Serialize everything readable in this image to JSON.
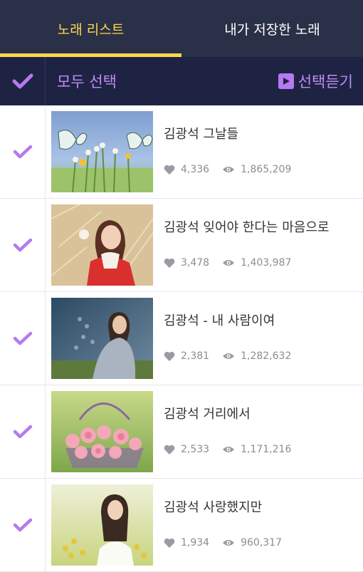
{
  "tabs": [
    {
      "label": "노래 리스트",
      "active": true
    },
    {
      "label": "내가 저장한 노래",
      "active": false
    }
  ],
  "select_bar": {
    "select_all_label": "모두 선택",
    "listen_label": "선택듣기"
  },
  "colors": {
    "accent_purple": "#b57af0",
    "tab_underline": "#ffd84a",
    "header_bg": "#2a3048",
    "selectbar_bg": "#1e2344"
  },
  "songs": [
    {
      "title": "김광석   그날들",
      "likes": "4,336",
      "views": "1,865,209",
      "thumb": "butterflies-flowers"
    },
    {
      "title": "김광석 잊어야 한다는 마음으로",
      "likes": "3,478",
      "views": "1,403,987",
      "thumb": "woman-pampas-grass"
    },
    {
      "title": "김광석 - 내 사람이여",
      "likes": "2,381",
      "views": "1,282,632",
      "thumb": "woman-sitting-field"
    },
    {
      "title": "김광석 거리에서",
      "likes": "2,533",
      "views": "1,171,216",
      "thumb": "rose-basket"
    },
    {
      "title": "김광석 사랑했지만",
      "likes": "1,934",
      "views": "960,317",
      "thumb": "woman-yellow-flowers"
    }
  ]
}
